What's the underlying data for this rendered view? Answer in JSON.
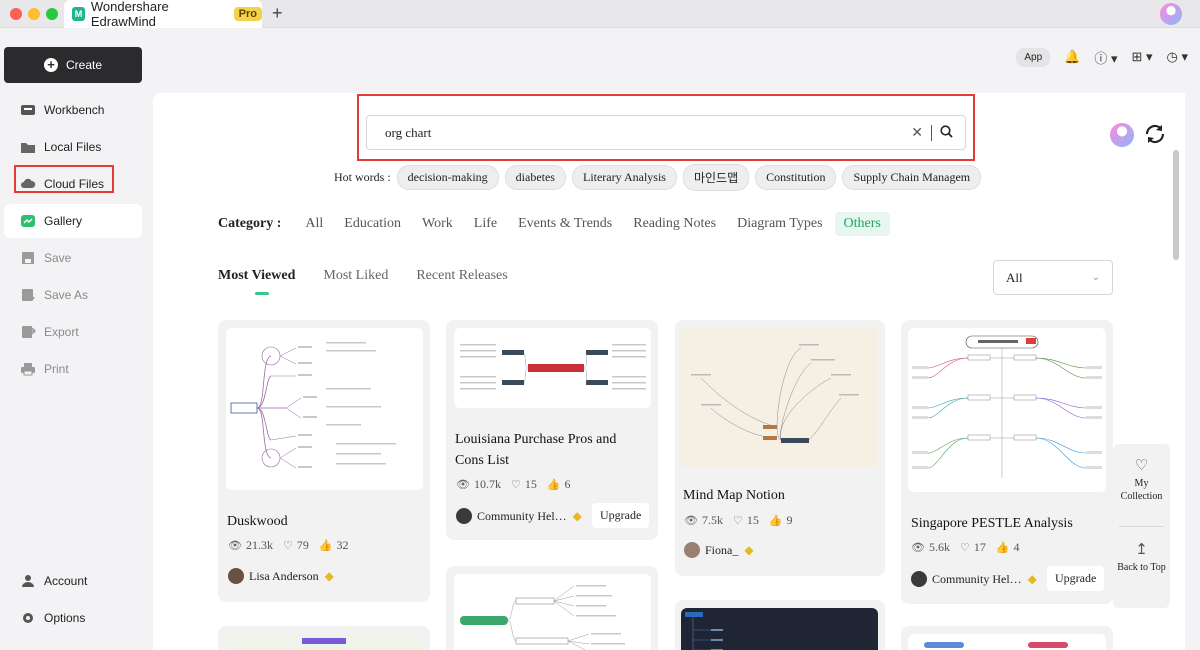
{
  "app": {
    "tab_title": "Wondershare EdrawMind",
    "pro_label": "Pro",
    "new_tab": "+"
  },
  "sidebar": {
    "create_label": "Create",
    "items": [
      {
        "label": "Workbench",
        "icon": "workbench-icon",
        "state": "normal"
      },
      {
        "label": "Local Files",
        "icon": "folder-icon",
        "state": "normal"
      },
      {
        "label": "Cloud Files",
        "icon": "cloud-icon",
        "state": "highlighted"
      },
      {
        "label": "Gallery",
        "icon": "gallery-icon",
        "state": "active"
      },
      {
        "label": "Save",
        "icon": "save-icon",
        "state": "disabled"
      },
      {
        "label": "Save As",
        "icon": "save-as-icon",
        "state": "disabled"
      },
      {
        "label": "Export",
        "icon": "export-icon",
        "state": "disabled"
      },
      {
        "label": "Print",
        "icon": "print-icon",
        "state": "disabled"
      }
    ],
    "bottom": [
      {
        "label": "Account",
        "icon": "account-icon"
      },
      {
        "label": "Options",
        "icon": "gear-icon"
      }
    ]
  },
  "toolbar": {
    "app_label": "App",
    "icons": [
      "bell-icon",
      "help-icon",
      "apps-grid-icon",
      "shirt-theme-icon"
    ]
  },
  "search": {
    "value": "org chart",
    "clear_glyph": "✕",
    "search_glyph": "⌕"
  },
  "hotwords": {
    "label": "Hot words :",
    "items": [
      "decision-making",
      "diabetes",
      "Literary Analysis",
      "마인드맵",
      "Constitution",
      "Supply Chain Managem"
    ]
  },
  "category": {
    "label": "Category :",
    "items": [
      "All",
      "Education",
      "Work",
      "Life",
      "Events & Trends",
      "Reading Notes",
      "Diagram Types",
      "Others"
    ],
    "active": "Others"
  },
  "sort": {
    "tabs": [
      "Most Viewed",
      "Most Liked",
      "Recent Releases"
    ],
    "active": "Most Viewed",
    "filter_value": "All"
  },
  "cards": [
    {
      "title": "Duskwood",
      "views": "21.3k",
      "likes": "79",
      "thumbs": "32",
      "author": "Lisa Anderson",
      "upgrade": ""
    },
    {
      "title": "Louisiana Purchase Pros and Cons List",
      "views": "10.7k",
      "likes": "15",
      "thumbs": "6",
      "author": "Community Hel…",
      "upgrade": "Upgrade"
    },
    {
      "title": "Mind Map Notion",
      "views": "7.5k",
      "likes": "15",
      "thumbs": "9",
      "author": "Fiona_",
      "upgrade": ""
    },
    {
      "title": "Singapore PESTLE Analysis",
      "views": "5.6k",
      "likes": "17",
      "thumbs": "4",
      "author": "Community Hel…",
      "upgrade": "Upgrade"
    }
  ],
  "float_panel": {
    "collection_label": "My Collection",
    "back_to_top_label": "Back to Top"
  },
  "colors": {
    "accent": "#20a565",
    "highlight_box": "#e23b3b",
    "gem": "#e9b821"
  }
}
